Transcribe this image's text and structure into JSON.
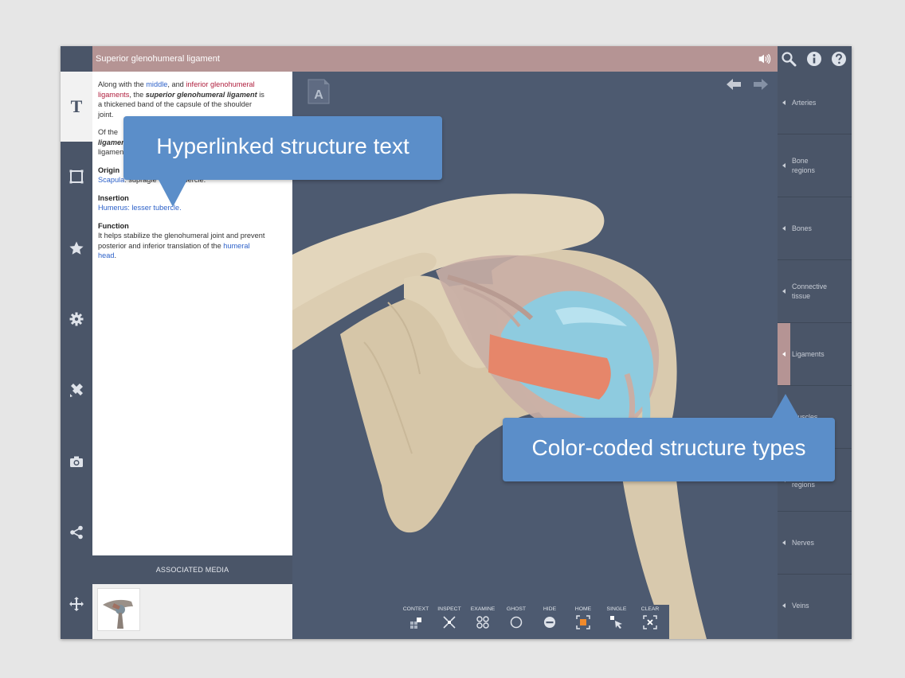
{
  "header": {
    "title": "Superior glenohumeral ligament"
  },
  "left_toolbar": {
    "text_tab_glyph": "T",
    "icons": [
      "text-tab",
      "frame-icon",
      "star-icon",
      "gear-icon",
      "tools-icon",
      "camera-icon",
      "share-icon",
      "move-icon"
    ]
  },
  "text_panel": {
    "para1_a": "Along with the ",
    "para1_link1": "middle",
    "para1_b": ", and ",
    "para1_link2": "inferior glenohumeral ligaments",
    "para1_c": ", the ",
    "para1_bold": "superior glenohumeral ligament",
    "para1_d": " is a thickened band of the capsule of the shoulder joint.",
    "para2_a": "Of the ",
    "para2_bold": "ligament",
    "para2_b": "ligamen",
    "origin_head": "Origin",
    "origin_link": "Scapula",
    "origin_text": ": supragle",
    "origin_tail": "bercle.",
    "insertion_head": "Insertion",
    "insertion_link": "Humerus: lesser tubercle.",
    "function_head": "Function",
    "function_text": "It helps stabilize the glenohumeral joint and prevent posterior and inferior translation of the ",
    "function_link": "humeral head",
    "function_end": "."
  },
  "associated_media": {
    "label": "ASSOCIATED MEDIA"
  },
  "viewer": {
    "badge_letter": "A",
    "tools": [
      {
        "label": "CONTEXT",
        "icon": "context-icon"
      },
      {
        "label": "INSPECT",
        "icon": "inspect-icon"
      },
      {
        "label": "EXAMINE",
        "icon": "examine-icon"
      },
      {
        "label": "GHOST",
        "icon": "ghost-icon"
      },
      {
        "label": "HIDE",
        "icon": "hide-icon"
      },
      {
        "label": "HOME",
        "icon": "home-icon"
      },
      {
        "label": "SINGLE",
        "icon": "single-icon"
      },
      {
        "label": "CLEAR",
        "icon": "clear-icon"
      }
    ]
  },
  "structure_types": {
    "items": [
      {
        "label": "Arteries"
      },
      {
        "label": "Bone regions"
      },
      {
        "label": "Bones"
      },
      {
        "label": "Connective tissue"
      },
      {
        "label": "Ligaments",
        "selected": true
      },
      {
        "label": "Muscles"
      },
      {
        "label": "Muscle regions"
      },
      {
        "label": "Nerves"
      },
      {
        "label": "Veins"
      }
    ]
  },
  "callouts": {
    "hyperlinked": "Hyperlinked structure text",
    "colorcoded": "Color-coded structure types"
  },
  "colors": {
    "title_bar": "#b59494",
    "panel_bg": "#4a5568",
    "callout": "#5b8ec9",
    "link_blue": "#2e62c9",
    "link_red": "#b0203f"
  }
}
